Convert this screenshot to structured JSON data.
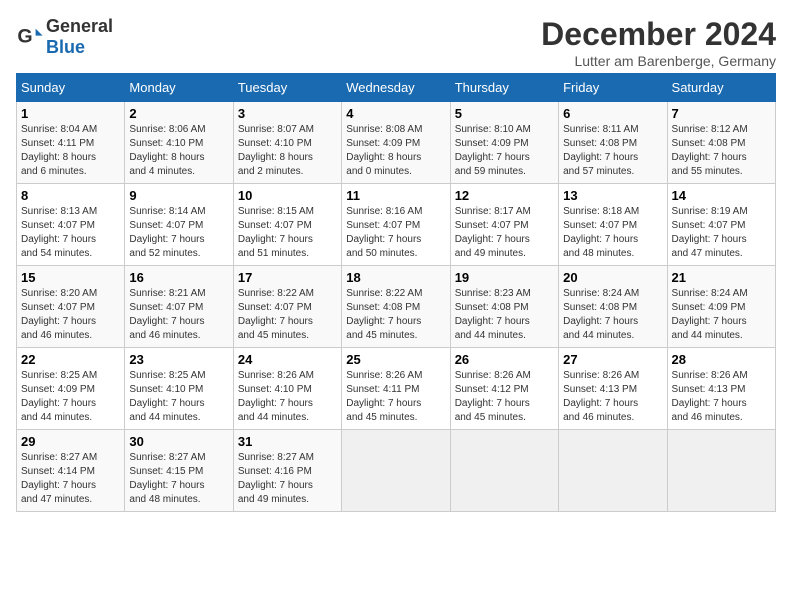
{
  "logo": {
    "general": "General",
    "blue": "Blue"
  },
  "header": {
    "month": "December 2024",
    "location": "Lutter am Barenberge, Germany"
  },
  "weekdays": [
    "Sunday",
    "Monday",
    "Tuesday",
    "Wednesday",
    "Thursday",
    "Friday",
    "Saturday"
  ],
  "weeks": [
    [
      {
        "day": "1",
        "sunrise": "8:04 AM",
        "sunset": "4:11 PM",
        "daylight": "8 hours and 6 minutes."
      },
      {
        "day": "2",
        "sunrise": "8:06 AM",
        "sunset": "4:10 PM",
        "daylight": "8 hours and 4 minutes."
      },
      {
        "day": "3",
        "sunrise": "8:07 AM",
        "sunset": "4:10 PM",
        "daylight": "8 hours and 2 minutes."
      },
      {
        "day": "4",
        "sunrise": "8:08 AM",
        "sunset": "4:09 PM",
        "daylight": "8 hours and 0 minutes."
      },
      {
        "day": "5",
        "sunrise": "8:10 AM",
        "sunset": "4:09 PM",
        "daylight": "7 hours and 59 minutes."
      },
      {
        "day": "6",
        "sunrise": "8:11 AM",
        "sunset": "4:08 PM",
        "daylight": "7 hours and 57 minutes."
      },
      {
        "day": "7",
        "sunrise": "8:12 AM",
        "sunset": "4:08 PM",
        "daylight": "7 hours and 55 minutes."
      }
    ],
    [
      {
        "day": "8",
        "sunrise": "8:13 AM",
        "sunset": "4:07 PM",
        "daylight": "7 hours and 54 minutes."
      },
      {
        "day": "9",
        "sunrise": "8:14 AM",
        "sunset": "4:07 PM",
        "daylight": "7 hours and 52 minutes."
      },
      {
        "day": "10",
        "sunrise": "8:15 AM",
        "sunset": "4:07 PM",
        "daylight": "7 hours and 51 minutes."
      },
      {
        "day": "11",
        "sunrise": "8:16 AM",
        "sunset": "4:07 PM",
        "daylight": "7 hours and 50 minutes."
      },
      {
        "day": "12",
        "sunrise": "8:17 AM",
        "sunset": "4:07 PM",
        "daylight": "7 hours and 49 minutes."
      },
      {
        "day": "13",
        "sunrise": "8:18 AM",
        "sunset": "4:07 PM",
        "daylight": "7 hours and 48 minutes."
      },
      {
        "day": "14",
        "sunrise": "8:19 AM",
        "sunset": "4:07 PM",
        "daylight": "7 hours and 47 minutes."
      }
    ],
    [
      {
        "day": "15",
        "sunrise": "8:20 AM",
        "sunset": "4:07 PM",
        "daylight": "7 hours and 46 minutes."
      },
      {
        "day": "16",
        "sunrise": "8:21 AM",
        "sunset": "4:07 PM",
        "daylight": "7 hours and 46 minutes."
      },
      {
        "day": "17",
        "sunrise": "8:22 AM",
        "sunset": "4:07 PM",
        "daylight": "7 hours and 45 minutes."
      },
      {
        "day": "18",
        "sunrise": "8:22 AM",
        "sunset": "4:08 PM",
        "daylight": "7 hours and 45 minutes."
      },
      {
        "day": "19",
        "sunrise": "8:23 AM",
        "sunset": "4:08 PM",
        "daylight": "7 hours and 44 minutes."
      },
      {
        "day": "20",
        "sunrise": "8:24 AM",
        "sunset": "4:08 PM",
        "daylight": "7 hours and 44 minutes."
      },
      {
        "day": "21",
        "sunrise": "8:24 AM",
        "sunset": "4:09 PM",
        "daylight": "7 hours and 44 minutes."
      }
    ],
    [
      {
        "day": "22",
        "sunrise": "8:25 AM",
        "sunset": "4:09 PM",
        "daylight": "7 hours and 44 minutes."
      },
      {
        "day": "23",
        "sunrise": "8:25 AM",
        "sunset": "4:10 PM",
        "daylight": "7 hours and 44 minutes."
      },
      {
        "day": "24",
        "sunrise": "8:26 AM",
        "sunset": "4:10 PM",
        "daylight": "7 hours and 44 minutes."
      },
      {
        "day": "25",
        "sunrise": "8:26 AM",
        "sunset": "4:11 PM",
        "daylight": "7 hours and 45 minutes."
      },
      {
        "day": "26",
        "sunrise": "8:26 AM",
        "sunset": "4:12 PM",
        "daylight": "7 hours and 45 minutes."
      },
      {
        "day": "27",
        "sunrise": "8:26 AM",
        "sunset": "4:13 PM",
        "daylight": "7 hours and 46 minutes."
      },
      {
        "day": "28",
        "sunrise": "8:26 AM",
        "sunset": "4:13 PM",
        "daylight": "7 hours and 46 minutes."
      }
    ],
    [
      {
        "day": "29",
        "sunrise": "8:27 AM",
        "sunset": "4:14 PM",
        "daylight": "7 hours and 47 minutes."
      },
      {
        "day": "30",
        "sunrise": "8:27 AM",
        "sunset": "4:15 PM",
        "daylight": "7 hours and 48 minutes."
      },
      {
        "day": "31",
        "sunrise": "8:27 AM",
        "sunset": "4:16 PM",
        "daylight": "7 hours and 49 minutes."
      },
      null,
      null,
      null,
      null
    ]
  ]
}
